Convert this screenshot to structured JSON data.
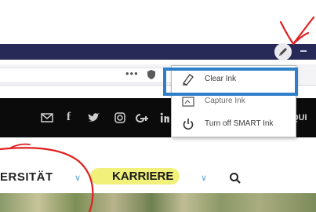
{
  "window": {
    "title_bar_color": "#272a56"
  },
  "toolbar": {
    "more_label": "•••"
  },
  "social_bar": {
    "trailing_text": "QUI"
  },
  "nav": {
    "item1": "ERSITÄT",
    "item2": "KARRIERE"
  },
  "ink_menu": {
    "items": [
      {
        "label": "Clear Ink",
        "icon": "eraser-icon"
      },
      {
        "label": "Capture Ink",
        "icon": "capture-icon"
      },
      {
        "label": "Turn off SMART Ink",
        "icon": "power-icon"
      }
    ]
  },
  "colors": {
    "highlight_border": "#2f7fc8",
    "ink_red": "#e02020",
    "highlighter_yellow": "#f1f07a"
  }
}
